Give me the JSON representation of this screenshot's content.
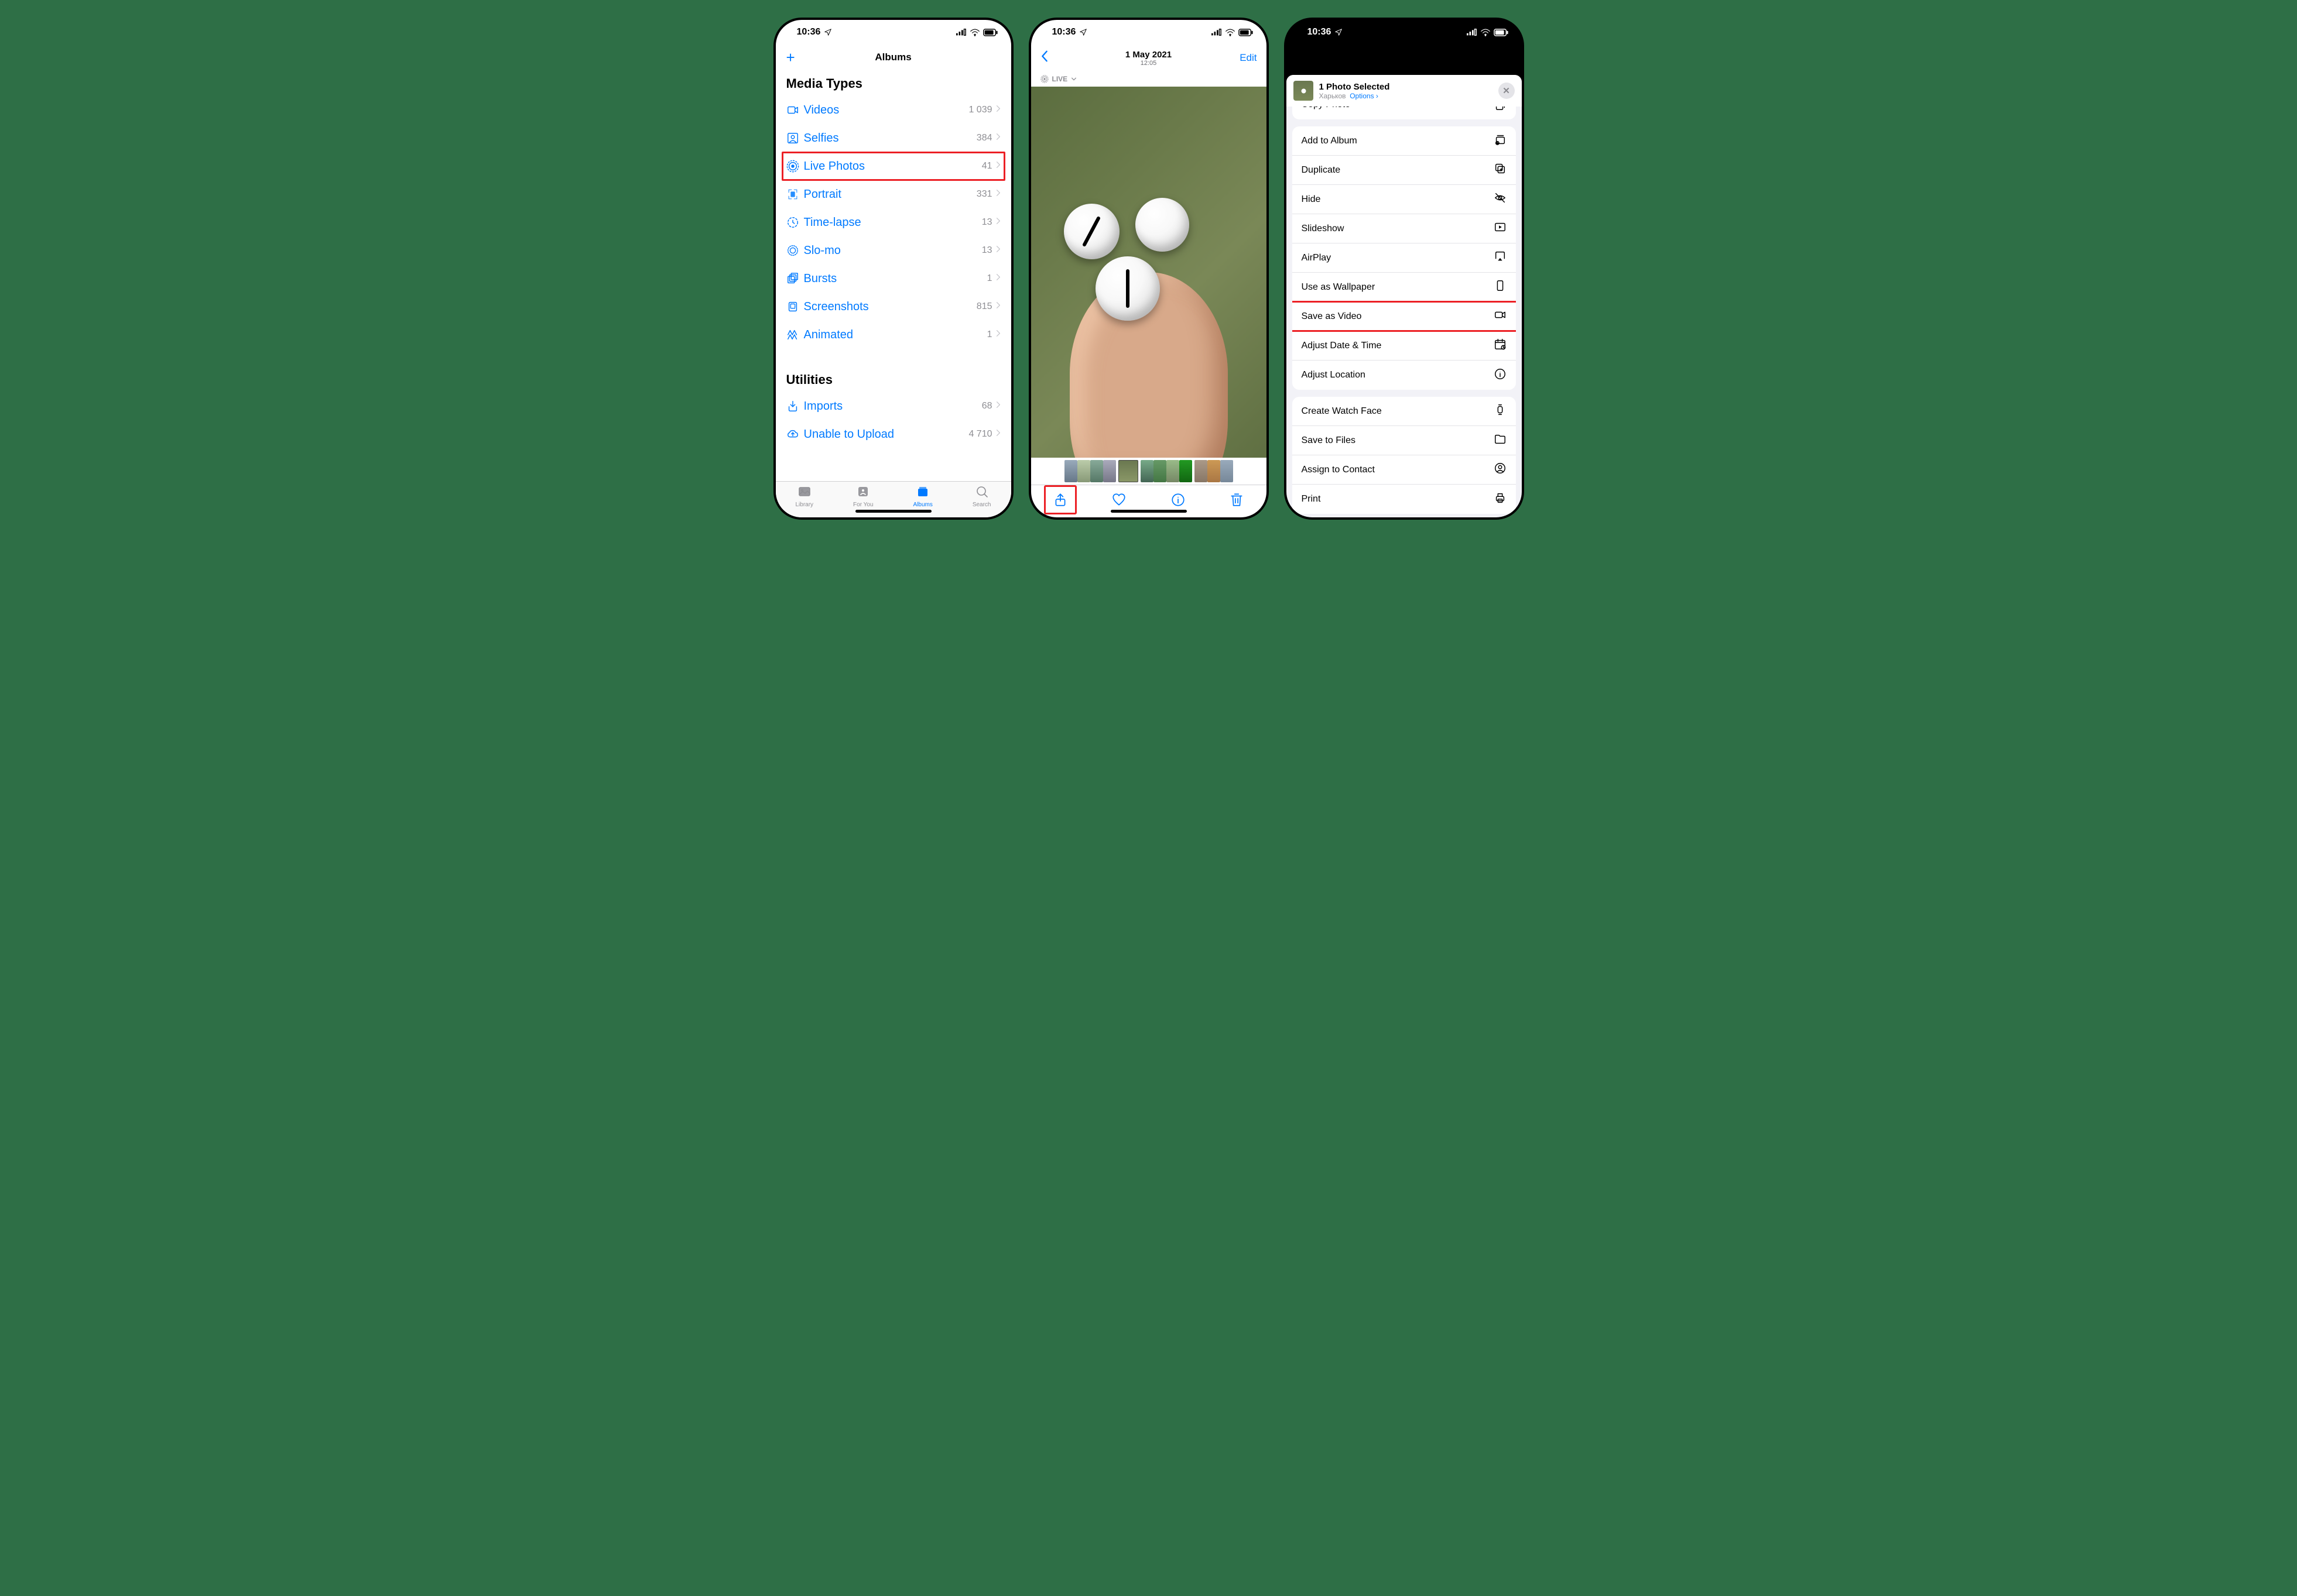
{
  "status": {
    "time": "10:36"
  },
  "screen1": {
    "nav_title": "Albums",
    "section_media": "Media Types",
    "section_utilities": "Utilities",
    "rows_media": [
      {
        "label": "Videos",
        "count": "1 039"
      },
      {
        "label": "Selfies",
        "count": "384"
      },
      {
        "label": "Live Photos",
        "count": "41",
        "highlight": true
      },
      {
        "label": "Portrait",
        "count": "331"
      },
      {
        "label": "Time-lapse",
        "count": "13"
      },
      {
        "label": "Slo-mo",
        "count": "13"
      },
      {
        "label": "Bursts",
        "count": "1"
      },
      {
        "label": "Screenshots",
        "count": "815"
      },
      {
        "label": "Animated",
        "count": "1"
      }
    ],
    "rows_util": [
      {
        "label": "Imports",
        "count": "68"
      },
      {
        "label": "Unable to Upload",
        "count": "4 710"
      }
    ],
    "tabs": [
      {
        "label": "Library"
      },
      {
        "label": "For You"
      },
      {
        "label": "Albums",
        "active": true
      },
      {
        "label": "Search"
      }
    ]
  },
  "screen2": {
    "date": "1 May 2021",
    "time": "12:05",
    "edit": "Edit",
    "live": "LIVE"
  },
  "screen3": {
    "title": "1 Photo Selected",
    "subtitle_location": "Харьков",
    "subtitle_options": "Options",
    "copy": "Copy Photo",
    "groups": [
      [
        {
          "label": "Add to Album",
          "icon": "album"
        },
        {
          "label": "Duplicate",
          "icon": "duplicate"
        },
        {
          "label": "Hide",
          "icon": "hide"
        },
        {
          "label": "Slideshow",
          "icon": "slideshow"
        },
        {
          "label": "AirPlay",
          "icon": "airplay"
        },
        {
          "label": "Use as Wallpaper",
          "icon": "wallpaper"
        },
        {
          "label": "Save as Video",
          "icon": "video",
          "highlight": true
        },
        {
          "label": "Adjust Date & Time",
          "icon": "date"
        },
        {
          "label": "Adjust Location",
          "icon": "location"
        }
      ],
      [
        {
          "label": "Create Watch Face",
          "icon": "watch"
        },
        {
          "label": "Save to Files",
          "icon": "files"
        },
        {
          "label": "Assign to Contact",
          "icon": "contact"
        },
        {
          "label": "Print",
          "icon": "print"
        }
      ]
    ]
  }
}
